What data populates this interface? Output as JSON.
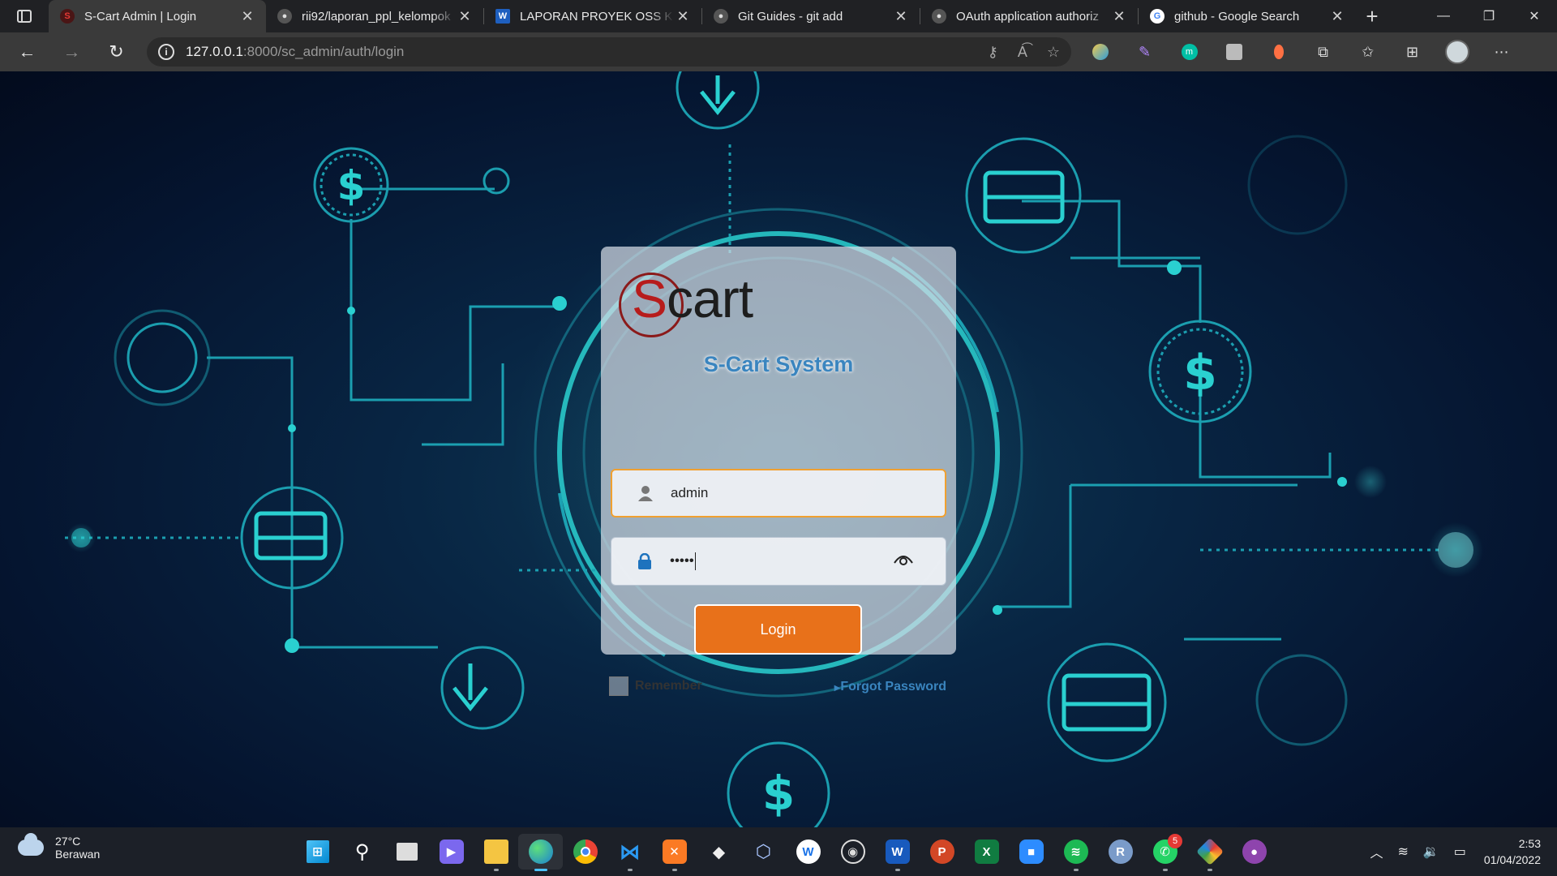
{
  "browser": {
    "tabs": [
      {
        "title": "S-Cart Admin | Login",
        "favicon": "scart-favicon",
        "active": true
      },
      {
        "title": "rii92/laporan_ppl_kelompok",
        "favicon": "github-favicon"
      },
      {
        "title": "LAPORAN PROYEK OSS KEL",
        "favicon": "word-favicon"
      },
      {
        "title": "Git Guides - git add",
        "favicon": "github-favicon"
      },
      {
        "title": "OAuth application authoriz",
        "favicon": "github-favicon"
      },
      {
        "title": "github - Google Search",
        "favicon": "google-favicon"
      }
    ],
    "address": {
      "host": "127.0.0.1",
      "path": ":8000/sc_admin/auth/login"
    }
  },
  "login": {
    "logo_s": "S",
    "logo_rest": "cart",
    "system_title": "S-Cart System",
    "username_value": "admin",
    "password_mask": "•••••",
    "login_label": "Login",
    "remember_label": "Remember",
    "forgot_label": "Forgot Password"
  },
  "taskbar": {
    "weather_temp": "27°C",
    "weather_desc": "Berawan",
    "whatsapp_badge": "5",
    "time": "2:53",
    "date": "01/04/2022"
  },
  "colors": {
    "accent": "#e8711a",
    "title_blue": "#3a85bf",
    "circuit": "#1fb5c4"
  }
}
